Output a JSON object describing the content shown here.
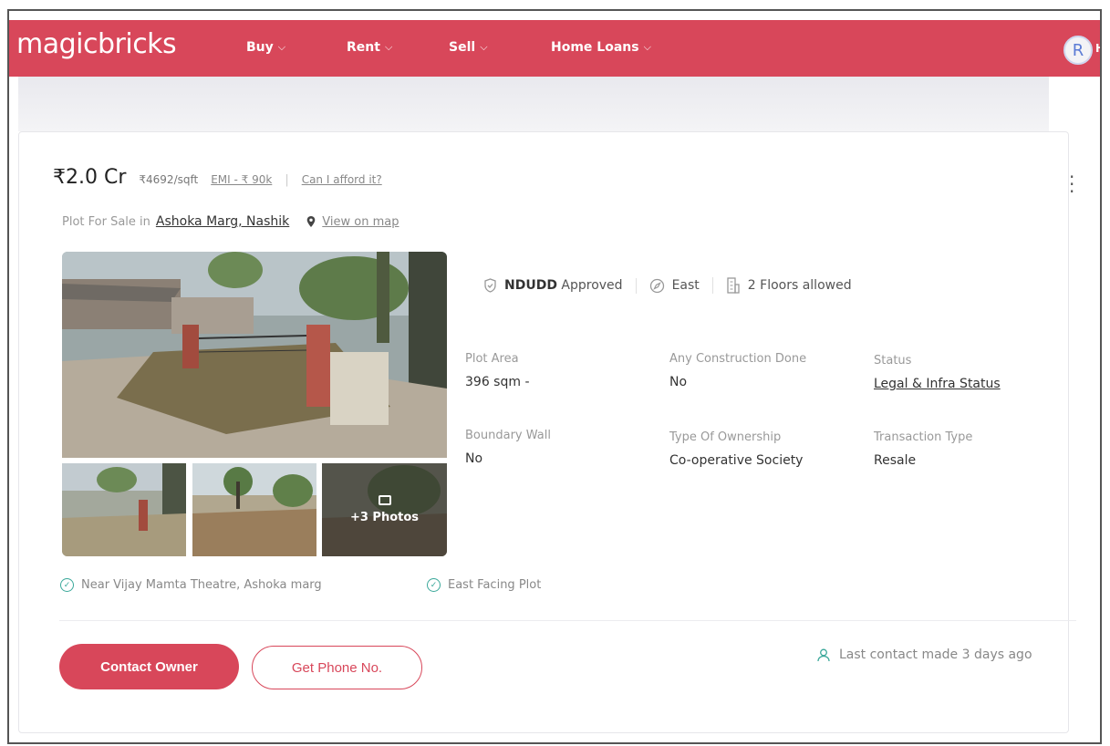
{
  "header": {
    "logo": "magicbricks",
    "nav": [
      {
        "label": "Buy"
      },
      {
        "label": "Rent"
      },
      {
        "label": "Sell"
      },
      {
        "label": "Home Loans"
      }
    ],
    "avatar_initial": "R",
    "avatar_tail": "H",
    "brand_color": "#d8475a"
  },
  "listing": {
    "price": "₹2.0 Cr",
    "price_per_sqft": "₹4692/sqft",
    "emi": "EMI - ₹ 90k",
    "afford_link": "Can I afford it?",
    "location_prefix": "Plot For Sale in",
    "location": "Ashoka Marg, Nashik",
    "map_link": "View on map",
    "photos_more": "+3 Photos",
    "tags": [
      {
        "bold": "NDUDD",
        "text": "Approved",
        "icon": "shield-check-icon"
      },
      {
        "bold": "",
        "text": "East",
        "icon": "compass-icon"
      },
      {
        "bold": "",
        "text": "2 Floors allowed",
        "icon": "building-icon"
      }
    ],
    "attributes": [
      {
        "label": "Plot Area",
        "value": "396 sqm -"
      },
      {
        "label": "Any Construction Done",
        "value": "No"
      },
      {
        "label": "Status",
        "value": "Legal & Infra Status"
      },
      {
        "label": "Boundary Wall",
        "value": "No"
      },
      {
        "label": "Type Of Ownership",
        "value": "Co-operative Society"
      },
      {
        "label": "Transaction Type",
        "value": "Resale"
      }
    ],
    "highlights": [
      "Near Vijay Mamta Theatre, Ashoka marg",
      "East Facing Plot"
    ],
    "contact_button": "Contact Owner",
    "phone_button": "Get Phone No.",
    "last_contact": "Last contact made 3 days ago"
  }
}
